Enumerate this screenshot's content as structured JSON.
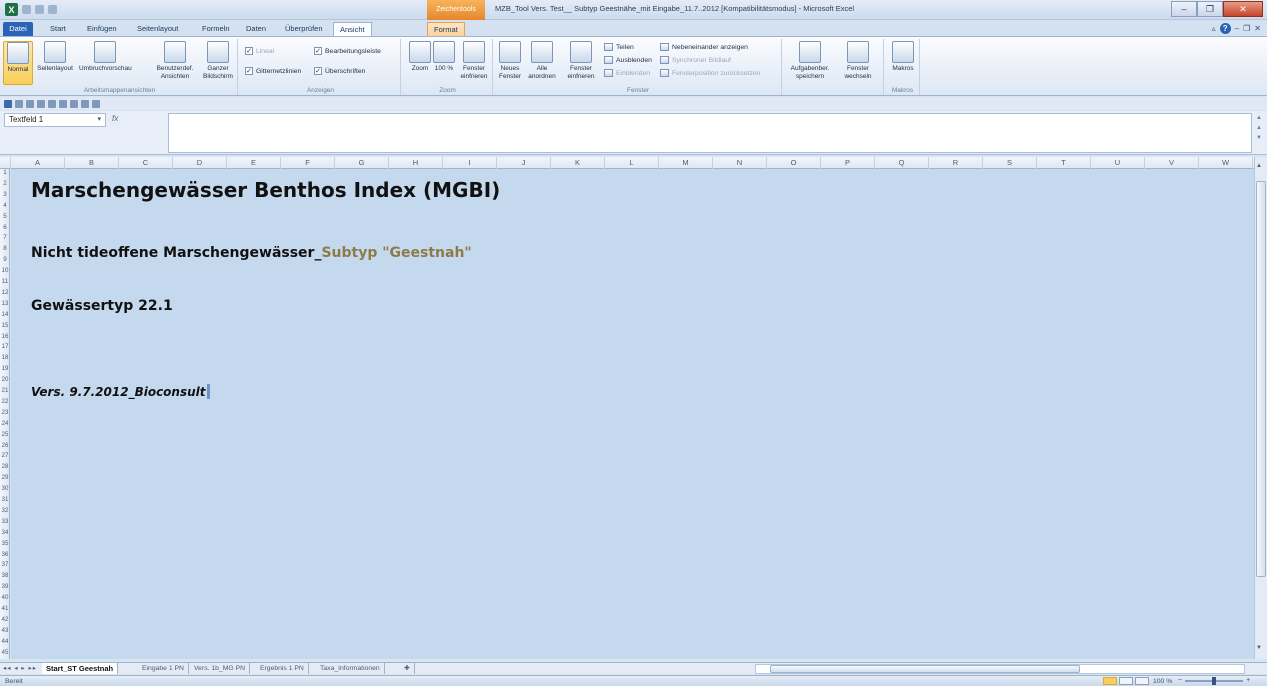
{
  "window": {
    "title": "MZB_Tool Vers. Test__ Subtyp Geestnähe_mit Eingabe_11.7..2012  [Kompatibilitätsmodus] - Microsoft Excel",
    "context_group": "Zeichentools",
    "app_icon": "X"
  },
  "tabs": [
    "Datei",
    "Start",
    "Einfügen",
    "Seitenlayout",
    "Formeln",
    "Daten",
    "Überprüfen",
    "Ansicht",
    "Format"
  ],
  "ribbon": {
    "workbook_views": {
      "label": "Arbeitsmappenansichten",
      "buttons": [
        "Normal",
        "Seitenlayout",
        "Umbruchvorschau",
        "Benutzerdef. Ansichten",
        "Ganzer Bildschirm"
      ]
    },
    "show": {
      "label": "Anzeigen",
      "ruler": "Lineal",
      "gridlines": "Gitternetzlinien",
      "formula_bar": "Bearbeitungsleiste",
      "headings": "Überschriften"
    },
    "zoom": {
      "label": "Zoom",
      "buttons": [
        "Zoom",
        "100 %",
        "Fenster einfrieren"
      ]
    },
    "window": {
      "label": "Fenster",
      "buttons": [
        "Neues Fenster",
        "Alle anordnen",
        "Fenster einfrieren"
      ],
      "split": "Teilen",
      "hide": "Ausblenden",
      "unhide": "Einblenden",
      "side_by_side": "Nebeneinander anzeigen",
      "sync_scroll": "Synchroner Bildlauf",
      "reset_position": "Fensterposition zurücksetzen",
      "save_workspace": "Aufgabenber. speichern",
      "switch_windows": "Fenster wechseln"
    },
    "macros": {
      "label": "Makros",
      "button": "Makros"
    }
  },
  "formula_bar": {
    "name_box": "Textfeld 1",
    "fx": "fx",
    "value": ""
  },
  "columns": [
    "A",
    "B",
    "C",
    "D",
    "E",
    "F",
    "G",
    "H",
    "I",
    "J",
    "K",
    "L",
    "M",
    "N",
    "O",
    "P",
    "Q",
    "R",
    "S",
    "T",
    "U",
    "V",
    "W"
  ],
  "rows_visible": 45,
  "textbox": {
    "title": "Marschengewässer Benthos Index  (MGBI)",
    "subtitle_main": "Nicht tideoffene Marschengewässer_",
    "subtitle_accent": "Subtyp \"Geestnah\"",
    "water_type": "Gewässertyp 22.1",
    "version": "Vers. 9.7.2012_Bioconsult"
  },
  "sheet_tabs": [
    "Start_ST Geestnah",
    "Eingabe 1 PN",
    "Vers. 1b_MG PN",
    "Ergebnis 1 PN",
    "Taxa_Informationen"
  ],
  "status": {
    "ready": "Bereit",
    "zoom": "100 %"
  },
  "colors": {
    "sheet_bg": "#c5d9ee",
    "accent_text": "#8c7a4b",
    "file_tab": "#2a63b5"
  }
}
